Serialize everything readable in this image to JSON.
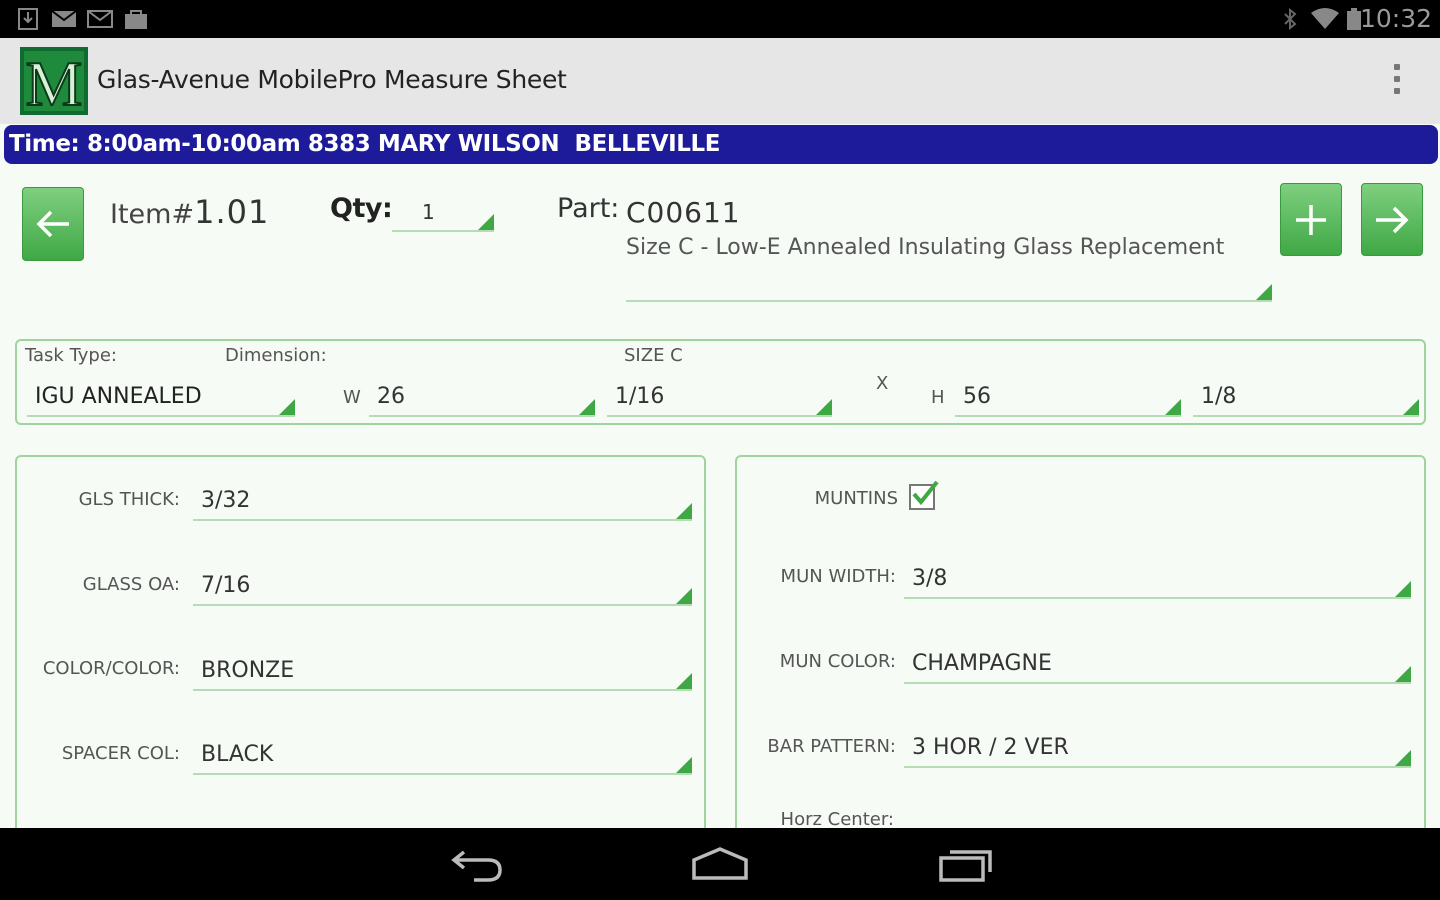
{
  "status_bar": {
    "time": "10:32"
  },
  "app": {
    "title": "Glas-Avenue MobilePro Measure Sheet",
    "logo_letter": "M"
  },
  "banner": {
    "text": "Time: 8:00am-10:00am 8383 MARY WILSON  BELLEVILLE"
  },
  "item": {
    "item_label": "Item#",
    "item_number": "1.01",
    "qty_label": "Qty:",
    "qty_value": "1",
    "part_label": "Part:",
    "part_code": "C00611",
    "part_description": "Size C - Low-E Annealed Insulating Glass Replacement"
  },
  "task": {
    "task_type_label": "Task Type:",
    "dimension_label": "Dimension:",
    "size_label": "SIZE C",
    "task_type_value": "IGU ANNEALED",
    "w_label": "W",
    "w_value": "26",
    "w_fraction": "1/16",
    "x_label": "X",
    "h_label": "H",
    "h_value": "56",
    "h_fraction": "1/8"
  },
  "left_panel": {
    "fields": [
      {
        "label": "GLS THICK:",
        "value": "3/32"
      },
      {
        "label": "GLASS OA:",
        "value": "7/16"
      },
      {
        "label": "COLOR/COLOR:",
        "value": "BRONZE"
      },
      {
        "label": "SPACER COL:",
        "value": "BLACK"
      }
    ]
  },
  "right_panel": {
    "muntins_label": "MUNTINS",
    "muntins_checked": true,
    "fields": [
      {
        "label": "MUN WIDTH:",
        "value": "3/8"
      },
      {
        "label": "MUN COLOR:",
        "value": "CHAMPAGNE"
      },
      {
        "label": "BAR PATTERN:",
        "value": "3 HOR / 2 VER"
      }
    ],
    "horz_center_label": "Horz Center:"
  },
  "colors": {
    "accent_green": "#3fa845",
    "banner_blue": "#1d1b9a",
    "panel_border": "#9fd49f"
  }
}
